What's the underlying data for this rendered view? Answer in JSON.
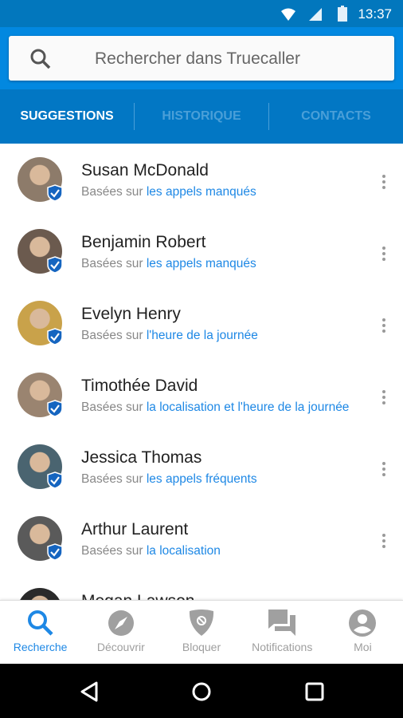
{
  "status": {
    "time": "13:37",
    "icons": [
      "wifi-icon",
      "signal-icon",
      "battery-icon"
    ]
  },
  "search": {
    "placeholder": "Rechercher dans Truecaller"
  },
  "tabs": [
    {
      "label": "SUGGESTIONS",
      "active": true
    },
    {
      "label": "HISTORIQUE",
      "active": false
    },
    {
      "label": "CONTACTS",
      "active": false
    }
  ],
  "contacts": [
    {
      "name": "Susan McDonald",
      "prefix": "Basées sur ",
      "reason": "les appels manqués",
      "color": "#8d7b6a"
    },
    {
      "name": "Benjamin Robert",
      "prefix": "Basées sur ",
      "reason": "les appels manqués",
      "color": "#6b5a4e"
    },
    {
      "name": "Evelyn Henry",
      "prefix": "Basées sur ",
      "reason": "l'heure de la journée",
      "color": "#c9a24a"
    },
    {
      "name": "Timothée David",
      "prefix": "Basées sur ",
      "reason": "la localisation et l'heure de la journée",
      "color": "#9a8470"
    },
    {
      "name": "Jessica Thomas",
      "prefix": "Basées sur ",
      "reason": "les appels fréquents",
      "color": "#4a6470"
    },
    {
      "name": "Arthur Laurent",
      "prefix": "Basées sur ",
      "reason": "la localisation",
      "color": "#5a5a5a"
    },
    {
      "name": "Megan Lawson",
      "prefix": "",
      "reason": "",
      "color": "#2a2a2a"
    }
  ],
  "bottom_nav": [
    {
      "label": "Recherche",
      "icon": "search-icon",
      "active": true
    },
    {
      "label": "Découvrir",
      "icon": "compass-icon"
    },
    {
      "label": "Bloquer",
      "icon": "block-shield-icon"
    },
    {
      "label": "Notifications",
      "icon": "chat-icon"
    },
    {
      "label": "Moi",
      "icon": "profile-icon"
    }
  ],
  "colors": {
    "primary": "#0288e0",
    "dark": "#0277bd",
    "accent": "#1e88e5"
  }
}
